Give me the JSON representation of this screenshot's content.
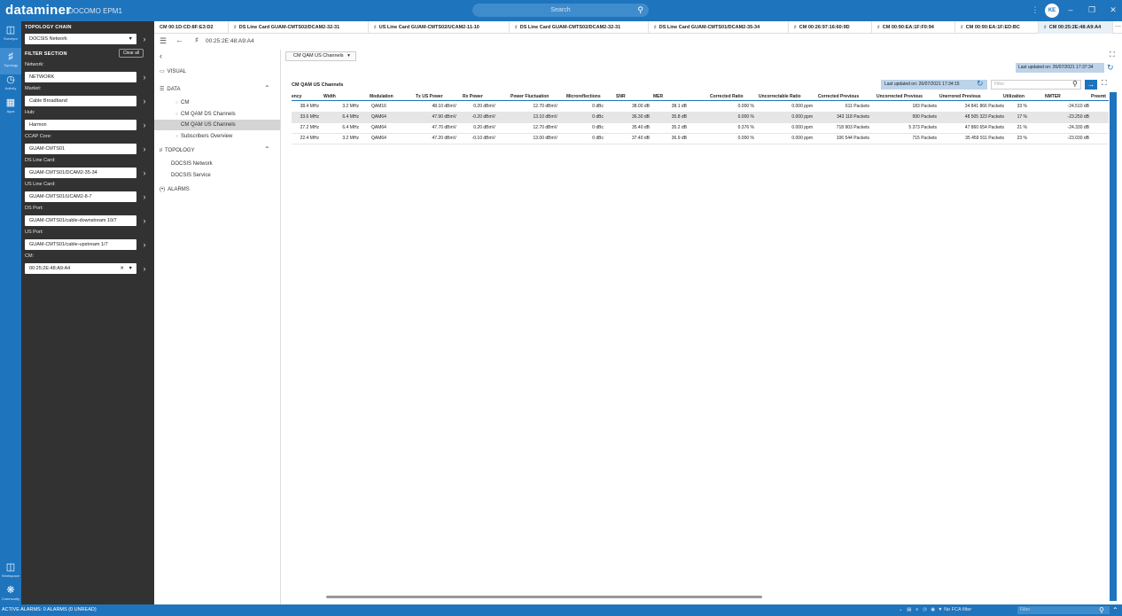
{
  "app": {
    "brand": "dataminer",
    "system": "DOCOMO EPM1",
    "search_placeholder": "Search",
    "user_initials": "KE"
  },
  "rail": [
    {
      "icon": "surveyor-icon",
      "label": "Surveyor"
    },
    {
      "icon": "topology-icon",
      "label": "Topology"
    },
    {
      "icon": "activity-icon",
      "label": "Activity"
    },
    {
      "icon": "apps-icon",
      "label": "Apps"
    },
    {
      "icon": "workspace-icon",
      "label": "Workspace"
    },
    {
      "icon": "community-icon",
      "label": "Community"
    }
  ],
  "panel": {
    "topology_chain_label": "TOPOLOGY CHAIN",
    "topology_chain_value": "DOCSIS Network",
    "filter_section_label": "FILTER SECTION",
    "clear_all": "Clear all",
    "fields": [
      {
        "label": "Network:",
        "value": "NETWORK"
      },
      {
        "label": "Market:",
        "value": "Cable Broadband"
      },
      {
        "label": "Hub:",
        "value": "Harmon"
      },
      {
        "label": "CCAP Core:",
        "value": "GUAM-CMTS01"
      },
      {
        "label": "DS Line Card:",
        "value": "GUAM-CMTS01/DCAM2-35-34"
      },
      {
        "label": "US Line Card:",
        "value": "GUAM-CMTS01/UCAM2-8-7"
      },
      {
        "label": "DS Port:",
        "value": "GUAM-CMTS01/cable-downstream 10/7"
      },
      {
        "label": "US Port:",
        "value": "GUAM-CMTS01/cable-upstream 1/7"
      },
      {
        "label": "CM:",
        "value": "00:25:2E:48:A9:A4"
      }
    ]
  },
  "tabs": [
    {
      "label": "CM 00:1D:CD:8F:E3:D2",
      "icon": false
    },
    {
      "label": "DS Line Card GUAM-CMTS02/DCAM2-32-31",
      "icon": true
    },
    {
      "label": "US Line Card GUAM-CMTS02/UCAM2-11-10",
      "icon": true
    },
    {
      "label": "DS Line Card GUAM-CMTS02/DCAM2-32-31",
      "icon": true
    },
    {
      "label": "DS Line Card GUAM-CMTS01/DCAM2-35-34",
      "icon": true
    },
    {
      "label": "CM 00:26:97:16:60:9D",
      "icon": true
    },
    {
      "label": "CM 00:90:EA:1F:F0:94",
      "icon": true
    },
    {
      "label": "CM 00:90:EA:1F:ED:BC",
      "icon": true
    },
    {
      "label": "CM 00:25:2E:48:A9:A4",
      "icon": true
    }
  ],
  "breadcrumb": "00:25:2E:48:A9:A4",
  "nav": {
    "visual": "VISUAL",
    "data": "DATA",
    "data_items": [
      "CM",
      "CM QAM DS Channels",
      "CM QAM US Channels",
      "Subscribers Overview"
    ],
    "topology": "TOPOLOGY",
    "topology_items": [
      "DOCSIS Network",
      "DOCSIS Service"
    ],
    "alarms": "ALARMS"
  },
  "main": {
    "dataset_select": "CM QAM US Channels",
    "last_updated_top": "Last updated on: 26/07/2021 17:37:34",
    "table_title": "CM QAM US Channels",
    "last_updated_table": "Last updated on: 26/07/2021 17:34:15",
    "filter_placeholder": "Filter",
    "columns": [
      "ency",
      "Width",
      "Modulation",
      "Tx US Power",
      "Rx Power",
      "Power Fluctuation",
      "Microreflections",
      "SNR",
      "MER",
      "Corrected Ratio",
      "Uncorrectable Ratio",
      "Corrected Previous",
      "Uncorrected Previous",
      "Unerrored Previous",
      "Utilization",
      "NMTER",
      "Preemt"
    ],
    "rows": [
      [
        "38.4 MHz",
        "3.2 MHz",
        "QAM16",
        "48.10 dBmV",
        "0.20 dBmV",
        "12.70 dBmV",
        "0 dBc",
        "38.00 dB",
        "38.1 dB",
        "0.000 %",
        "0.000 ppm",
        "611 Packets",
        "183 Packets",
        "34 841 866 Packets",
        "33 %",
        "-24.510 dB",
        ""
      ],
      [
        "33.6 MHz",
        "6.4 MHz",
        "QAM64",
        "47.90 dBmV",
        "-0.20 dBmV",
        "13.10 dBmV",
        "0 dBc",
        "36.30 dB",
        "35.8 dB",
        "0.000 %",
        "0.000 ppm",
        "343 118 Packets",
        "990 Packets",
        "48 505 323 Packets",
        "17 %",
        "-23.250 dB",
        ""
      ],
      [
        "27.2 MHz",
        "6.4 MHz",
        "QAM64",
        "47.70 dBmV",
        "0.20 dBmV",
        "12.70 dBmV",
        "0 dBc",
        "35.40 dB",
        "35.2 dB",
        "0.376 %",
        "0.000 ppm",
        "718 903 Packets",
        "5 373 Packets",
        "47 860 654 Packets",
        "21 %",
        "-24.330 dB",
        ""
      ],
      [
        "22.4 MHz",
        "3.2 MHz",
        "QAM64",
        "47.20 dBmV",
        "-0.10 dBmV",
        "13.00 dBmV",
        "0 dBc",
        "37.40 dB",
        "36.9 dB",
        "0.000 %",
        "0.000 ppm",
        "106 544 Packets",
        "715 Packets",
        "35 459 911 Packets",
        "23 %",
        "-23.030 dB",
        ""
      ]
    ]
  },
  "status": {
    "alarms": "ACTIVE ALARMS: 0 ALARMS (0 UNREAD)",
    "fca": "No FCA filter",
    "filter_placeholder": "Filter"
  },
  "colors": {
    "accent": "#1e74bd",
    "panel": "#323232"
  }
}
